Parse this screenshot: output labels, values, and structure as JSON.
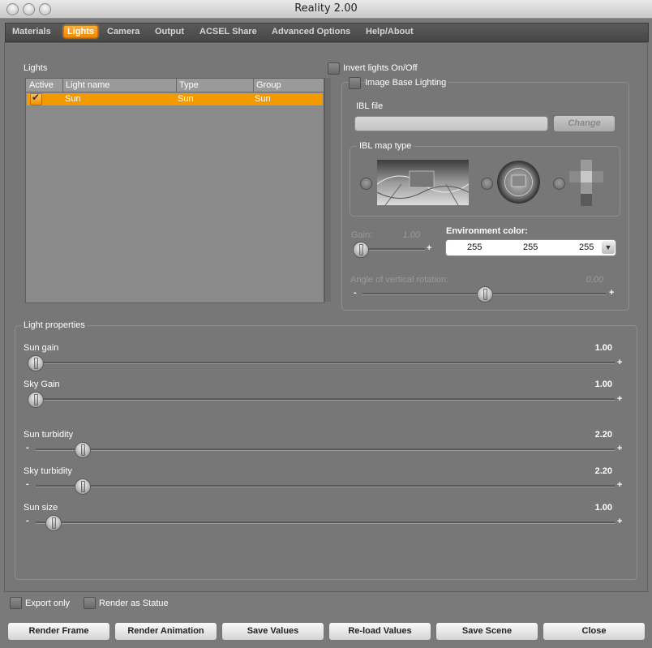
{
  "window": {
    "title": "Reality  2.00"
  },
  "tabs": [
    {
      "label": "Materials",
      "active": false
    },
    {
      "label": "Lights",
      "active": true
    },
    {
      "label": "Camera",
      "active": false
    },
    {
      "label": "Output",
      "active": false
    },
    {
      "label": "ACSEL Share",
      "active": false
    },
    {
      "label": "Advanced Options",
      "active": false
    },
    {
      "label": "Help/About",
      "active": false
    }
  ],
  "lights": {
    "section_label": "Lights",
    "columns": [
      "Active",
      "Light name",
      "Type",
      "Group"
    ],
    "rows": [
      {
        "active": true,
        "name": "Sun",
        "type": "Sun",
        "group": "Sun"
      }
    ]
  },
  "invert_lights": {
    "label": "Invert lights On/Off",
    "checked": false
  },
  "ibl": {
    "label": "Image Base Lighting",
    "checked": false,
    "file_label": "IBL file",
    "file_value": "",
    "change_button": "Change",
    "map_type_label": "IBL map type",
    "gain_label": "Gain:",
    "gain_value": "1.00",
    "gain_level": 0.05,
    "env_color_label": "Environment color:",
    "env_color": {
      "r": "255",
      "g": "255",
      "b": "255"
    },
    "rotation_label": "Angle of vertical rotation:",
    "rotation_value": "0.00",
    "rotation_level": 0.5
  },
  "light_properties": {
    "label": "Light properties",
    "sliders": [
      {
        "label": "Sun gain",
        "value": "1.00",
        "level": 0.01
      },
      {
        "label": "Sky Gain",
        "value": "1.00",
        "level": 0.01
      },
      {
        "label": "Sun turbidity",
        "value": "2.20",
        "level": 0.08
      },
      {
        "label": "Sky turbidity",
        "value": "2.20",
        "level": 0.08
      },
      {
        "label": "Sun size",
        "value": "1.00",
        "level": 0.03
      }
    ]
  },
  "options": {
    "export_only": {
      "label": "Export only",
      "checked": false
    },
    "render_as_statue": {
      "label": "Render as Statue",
      "checked": false
    }
  },
  "footer_buttons": {
    "render_frame": "Render Frame",
    "render_animation": "Render Animation",
    "save_values": "Save Values",
    "reload_values": "Re-load Values",
    "save_scene": "Save Scene",
    "close": "Close"
  },
  "symbols": {
    "minus": "-",
    "plus": "+"
  },
  "colors": {
    "accent": "#f39a00",
    "panel": "#777777"
  }
}
